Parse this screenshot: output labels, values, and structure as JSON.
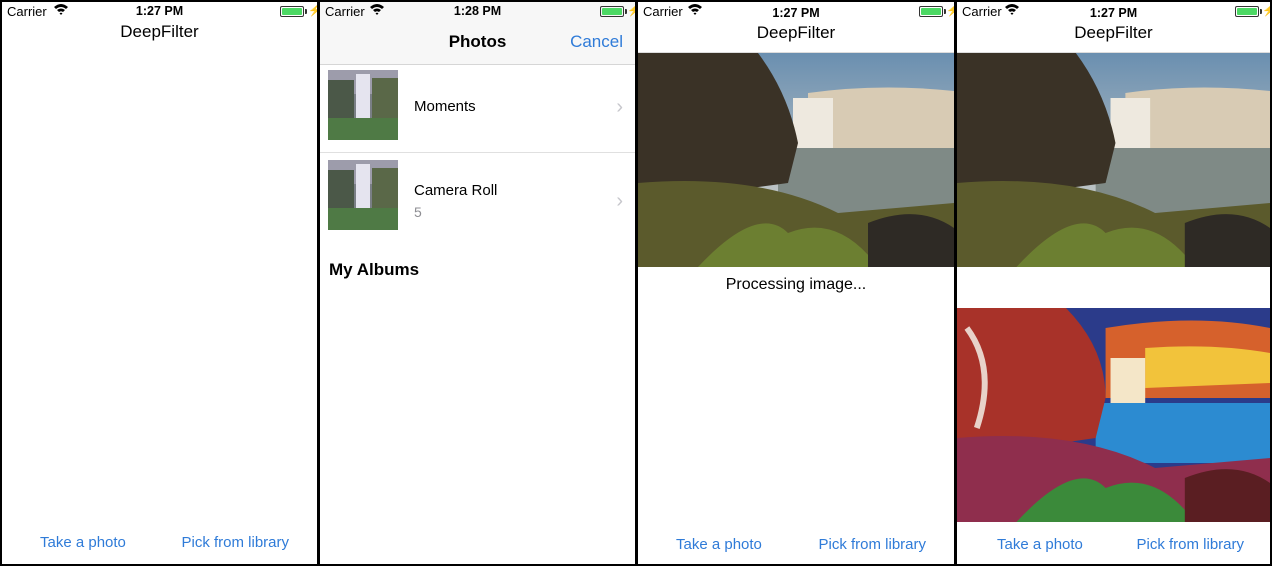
{
  "status": {
    "carrier": "Carrier",
    "time_1": "1:27 PM",
    "time_2": "1:28 PM",
    "time_3": "1:27 PM",
    "time_4": "1:27 PM"
  },
  "app": {
    "title": "DeepFilter"
  },
  "actions": {
    "take_photo": "Take a photo",
    "pick_library": "Pick from library"
  },
  "picker": {
    "title": "Photos",
    "cancel": "Cancel",
    "albums": [
      {
        "name": "Moments",
        "count": ""
      },
      {
        "name": "Camera Roll",
        "count": "5"
      }
    ],
    "section_title": "My Albums"
  },
  "processing": {
    "message": "Processing image..."
  },
  "colors": {
    "accent": "#2f7bd8",
    "battery": "#4cd964"
  }
}
